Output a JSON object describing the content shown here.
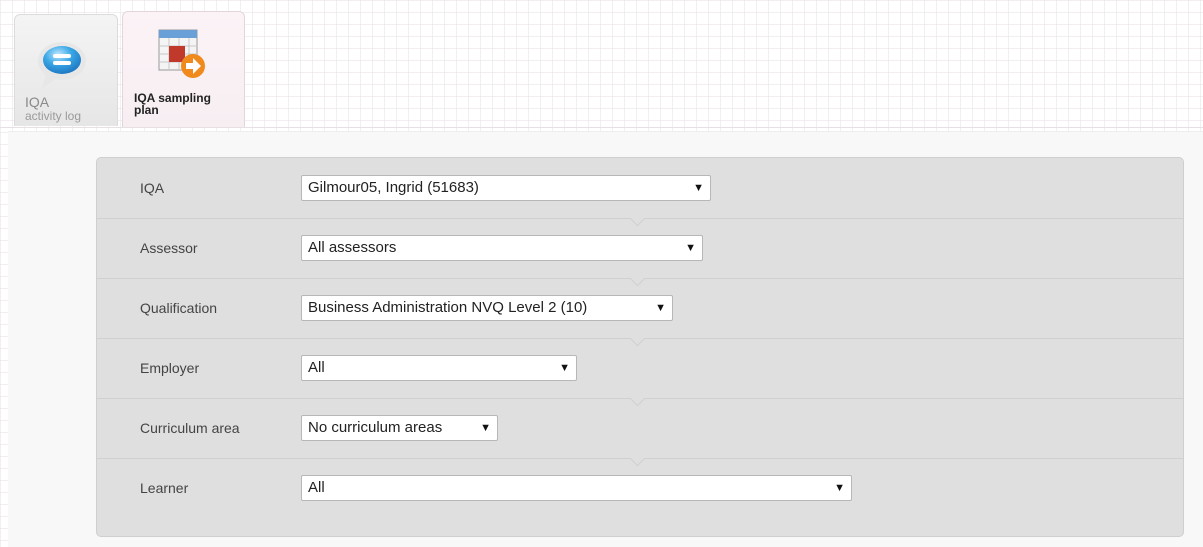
{
  "tabs": [
    {
      "label_line1": "IQA",
      "label_line2": "activity log",
      "icon": "speech-bubble-icon",
      "active": false
    },
    {
      "label_line1": "IQA sampling",
      "label_line2": "plan",
      "icon": "calendar-arrow-icon",
      "active": true
    }
  ],
  "filters": [
    {
      "label": "IQA",
      "value": "Gilmour05, Ingrid (51683)"
    },
    {
      "label": "Assessor",
      "value": "All assessors"
    },
    {
      "label": "Qualification",
      "value": "Business Administration NVQ Level 2 (10)"
    },
    {
      "label": "Employer",
      "value": "All"
    },
    {
      "label": "Curriculum area",
      "value": "No curriculum areas"
    },
    {
      "label": "Learner",
      "value": "All"
    }
  ],
  "dropdown_arrow": "▼",
  "colors": {
    "panel_bg": "#dfdfdf",
    "bubble_blue": "#3aa7e6",
    "arrow_orange": "#f08a1c"
  }
}
